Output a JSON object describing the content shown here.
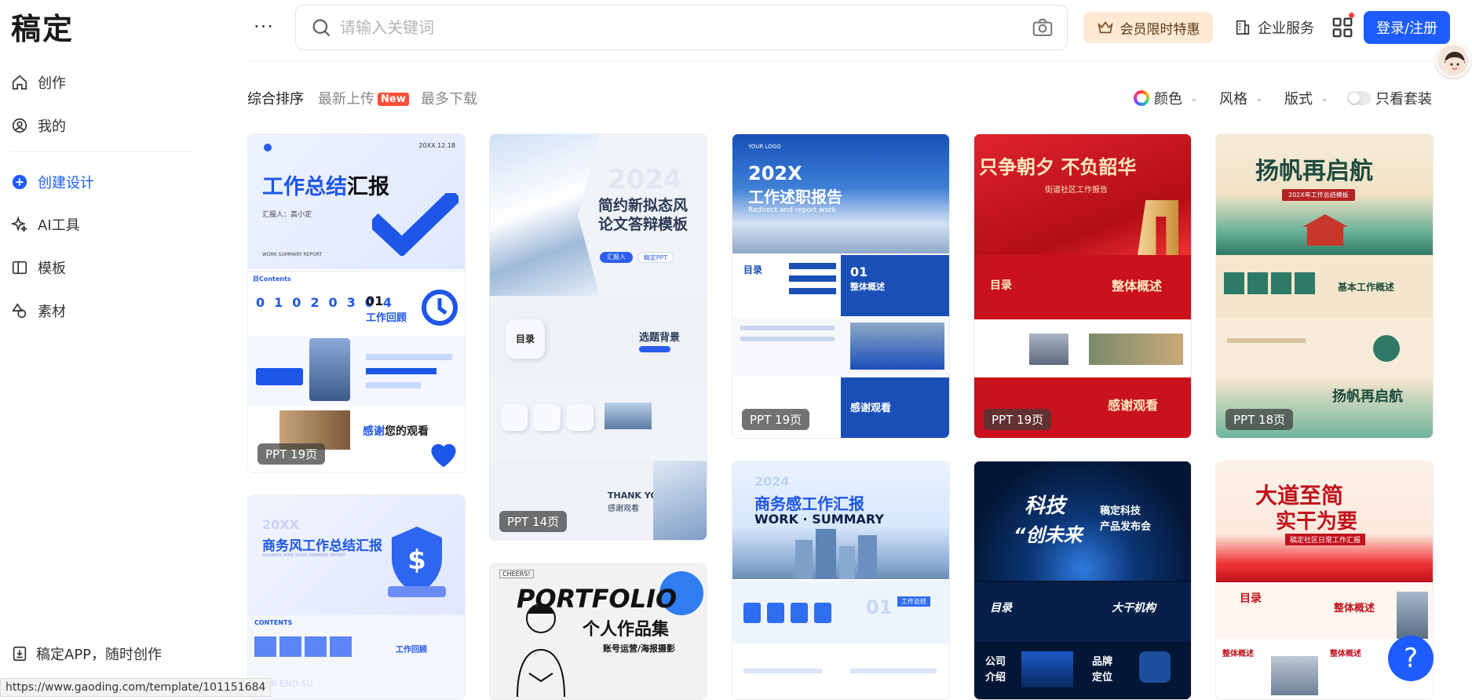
{
  "app": {
    "logo_text": "稿定"
  },
  "sidebar": {
    "items": [
      {
        "label": "创作",
        "icon": "home-icon"
      },
      {
        "label": "我的",
        "icon": "user-icon"
      },
      {
        "label": "创建设计",
        "icon": "plus-circle-icon"
      },
      {
        "label": "AI工具",
        "icon": "sparkle-icon"
      },
      {
        "label": "模板",
        "icon": "template-icon"
      },
      {
        "label": "素材",
        "icon": "shapes-icon"
      }
    ],
    "app_download": "稿定APP，随时创作"
  },
  "header": {
    "more": "···",
    "search_placeholder": "请输入关键词",
    "vip_label": "会员限时特惠",
    "enterprise_label": "企业服务",
    "login_label": "登录/注册"
  },
  "sort": {
    "items": [
      "综合排序",
      "最新上传",
      "最多下载"
    ],
    "new_badge": "New"
  },
  "filters": {
    "color": "颜色",
    "style": "风格",
    "layout": "版式",
    "only_sets": "只看套装"
  },
  "cards": [
    {
      "badge": "PPT  19页",
      "title": "工作总结",
      "title_highlight": "汇报",
      "subtitle": "汇报人：高小定",
      "footer": "WORK SUMMARY REPORT",
      "year": "20XX.12.18",
      "section": "工作回顾",
      "num": "01",
      "thanks": "感谢",
      "thanks2": "您的观看",
      "contents": "目Contents"
    },
    {
      "badge": "PPT  14页",
      "title": "简约新拟态风",
      "title2": "论文答辩模板",
      "year": "2024",
      "tag1": "汇报人",
      "tag2": "稿定PPT",
      "section": "选题背景",
      "menu": "目录",
      "thanks": "THANK YOU",
      "thanks2": "感谢观看"
    },
    {
      "badge": "PPT  19页",
      "title": "202X",
      "title2": "工作述职报告",
      "sub": "Redirect and report work",
      "logo": "YOUR LOGO",
      "menu": "目录",
      "section": "整体概述",
      "num": "01",
      "thanks": "感谢观看"
    },
    {
      "badge": "PPT  19页",
      "title": "只争朝夕 不负韶华",
      "sub": "街道社区工作报告",
      "menu": "目录",
      "section": "整体概述",
      "thanks": "感谢观看"
    },
    {
      "badge": "PPT  18页",
      "title": "扬帆再启航",
      "sub": "202X年工作总结模板",
      "menu": "目录",
      "section": "基本工作概述"
    },
    {
      "badge": "",
      "title": "商务风工作总结汇报",
      "year": "20XX",
      "footer": "BUSINESS WIND WORK SUMMARY REPORT",
      "section": "工作回顾",
      "contents": "CONTENTS",
      "bottom": "YEAR END SU"
    },
    {
      "badge": "",
      "title": "PORTFOLIO",
      "title2": "个人作品集",
      "sub": "账号运营/海报摄影",
      "tag": "CHEERS!"
    },
    {
      "badge": "",
      "title": "商务感工作汇报",
      "title2": "WORK · SUMMARY",
      "year": "2024",
      "num": "01",
      "section": "工作总结"
    },
    {
      "badge": "",
      "title": "科技",
      "title2": "“创未来",
      "sub": "稿定科技",
      "sub2": "产品发布会",
      "menu": "目录",
      "section": "大干机构",
      "s1": "公司",
      "s2": "介绍",
      "s3": "品牌",
      "s4": "定位"
    },
    {
      "badge": "",
      "title": "大道至简",
      "title2": "实干为要",
      "sub": "稿定社区日常工作汇报",
      "menu": "目录",
      "section": "整体概述",
      "s1": "整体概述",
      "s2": "整体概述"
    }
  ],
  "status_url": "https://www.gaoding.com/template/101151684",
  "help": "?"
}
